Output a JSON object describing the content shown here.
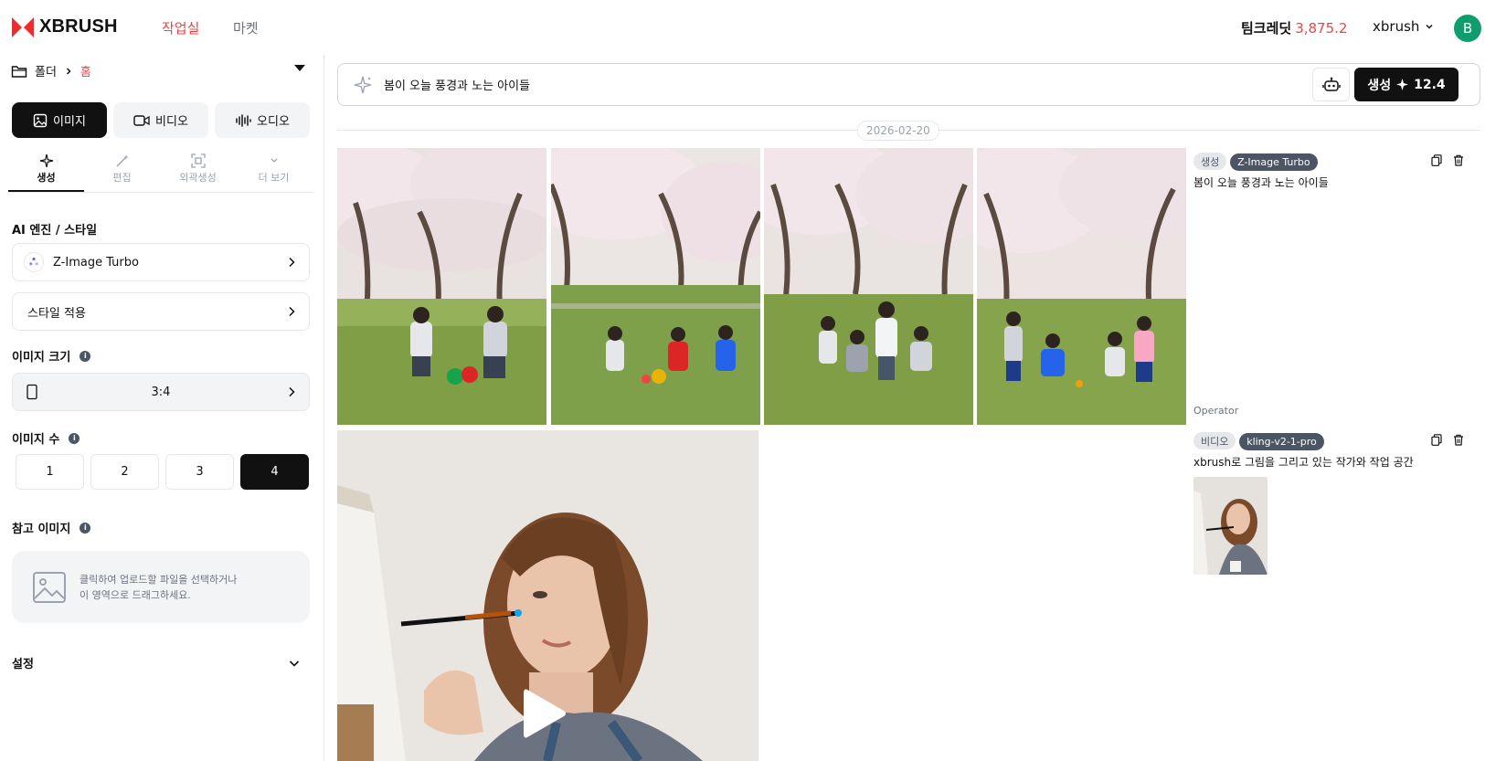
{
  "header": {
    "brand": "XBRUSH",
    "nav": [
      {
        "label": "작업실",
        "active": true
      },
      {
        "label": "마켓",
        "active": false
      }
    ],
    "credits_label": "팀크레딧",
    "credits_value": "3,875.2",
    "username": "xbrush",
    "avatar_initial": "B",
    "accent_color": "#ef4444"
  },
  "sidebar": {
    "breadcrumb": {
      "folder": "폴더",
      "current": "홈"
    },
    "modes": [
      {
        "label": "이미지",
        "icon": "image-icon",
        "active": true
      },
      {
        "label": "비디오",
        "icon": "video-icon",
        "active": false
      },
      {
        "label": "오디오",
        "icon": "audio-wave-icon",
        "active": false
      }
    ],
    "subtabs": [
      {
        "label": "생성",
        "icon": "sparkle-icon",
        "active": true
      },
      {
        "label": "편집",
        "icon": "wand-icon",
        "active": false
      },
      {
        "label": "외곽생성",
        "icon": "expand-icon",
        "active": false
      },
      {
        "label": "더 보기",
        "icon": "chevron-down-icon",
        "active": false
      }
    ],
    "engine_section": "AI 엔진 / 스타일",
    "engine_value": "Z-Image Turbo",
    "style_value": "스타일 적용",
    "size_section": "이미지 크기",
    "size_value": "3:4",
    "count_section": "이미지 수",
    "counts": [
      "1",
      "2",
      "3",
      "4"
    ],
    "selected_count": "4",
    "reference_section": "참고 이미지",
    "upload_line1": "클릭하여 업로드할 파일을 선택하거나",
    "upload_line2": "이 영역으로 드래그하세요.",
    "settings_label": "설정"
  },
  "prompt": {
    "value": "봄이 오늘 풍경과 노는 아이들",
    "generate_label": "생성",
    "generate_cost": "12.4"
  },
  "feed": {
    "date": "2026-02-20",
    "entries": [
      {
        "type_tag": "생성",
        "model_tag": "Z-Image Turbo",
        "prompt": "봄이 오늘 풍경과 노는 아이들"
      },
      {
        "operator": "Operator",
        "type_tag": "비디오",
        "model_tag": "kling-v2-1-pro",
        "prompt": "xbrush로 그림을 그리고 있는 작가와 작업 공간"
      }
    ]
  }
}
